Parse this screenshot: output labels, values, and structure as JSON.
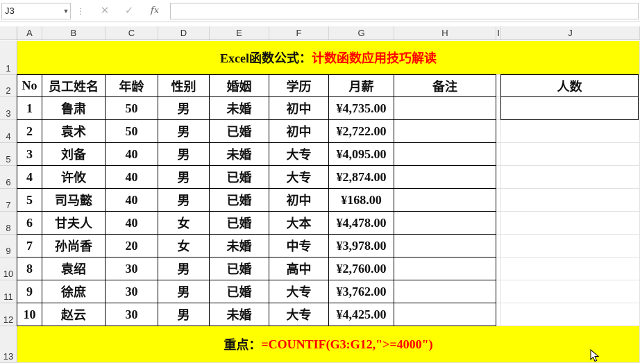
{
  "formula_bar": {
    "name_box": "J3",
    "fx_label": "fx",
    "cancel_glyph": "✕",
    "enter_glyph": "✓",
    "menu_dots": "⋮",
    "formula": ""
  },
  "columns": [
    "A",
    "B",
    "C",
    "D",
    "E",
    "F",
    "G",
    "H",
    "I",
    "J"
  ],
  "rows": [
    "1",
    "2",
    "3",
    "4",
    "5",
    "6",
    "7",
    "8",
    "9",
    "10",
    "11",
    "12",
    "13"
  ],
  "title": {
    "prefix": "Excel函数公式：",
    "suffix": "计数函数应用技巧解读"
  },
  "headers": [
    "No",
    "员工姓名",
    "年龄",
    "性别",
    "婚姻",
    "学历",
    "月薪",
    "备注"
  ],
  "side_header": "人数",
  "side_value": "",
  "records": [
    [
      "1",
      "鲁肃",
      "50",
      "男",
      "未婚",
      "初中",
      "¥4,735.00",
      ""
    ],
    [
      "2",
      "袁术",
      "50",
      "男",
      "已婚",
      "初中",
      "¥2,722.00",
      ""
    ],
    [
      "3",
      "刘备",
      "40",
      "男",
      "未婚",
      "大专",
      "¥4,095.00",
      ""
    ],
    [
      "4",
      "许攸",
      "40",
      "男",
      "已婚",
      "大专",
      "¥2,874.00",
      ""
    ],
    [
      "5",
      "司马懿",
      "40",
      "男",
      "已婚",
      "初中",
      "¥168.00",
      ""
    ],
    [
      "6",
      "甘夫人",
      "40",
      "女",
      "已婚",
      "大本",
      "¥4,478.00",
      ""
    ],
    [
      "7",
      "孙尚香",
      "20",
      "女",
      "未婚",
      "中专",
      "¥3,978.00",
      ""
    ],
    [
      "8",
      "袁绍",
      "30",
      "男",
      "已婚",
      "高中",
      "¥2,760.00",
      ""
    ],
    [
      "9",
      "徐庶",
      "30",
      "男",
      "已婚",
      "大专",
      "¥3,762.00",
      ""
    ],
    [
      "10",
      "赵云",
      "30",
      "男",
      "未婚",
      "大专",
      "¥4,425.00",
      ""
    ]
  ],
  "footer": {
    "label": "重点：",
    "formula": "=COUNTIF(G3:G12,\">=4000\")"
  },
  "colors": {
    "highlight": "#ffff00",
    "accent_text": "#ff0000"
  }
}
